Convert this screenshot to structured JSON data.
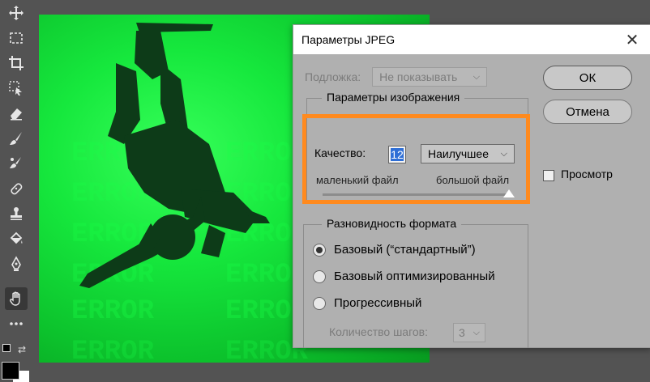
{
  "dialog": {
    "title": "Параметры JPEG",
    "matte_label": "Подложка:",
    "matte_value": "Не показывать",
    "image_options": {
      "title": "Параметры изображения",
      "quality_label": "Качество:",
      "quality_value": "12",
      "quality_preset": "Наилучшее",
      "small_file_label": "маленький файл",
      "large_file_label": "большой файл",
      "quality_slider_fraction": 1.0
    },
    "format_options": {
      "title": "Разновидность формата",
      "options": [
        {
          "label": "Базовый (“стандартный”)",
          "checked": true
        },
        {
          "label": "Базовый оптимизированный",
          "checked": false
        },
        {
          "label": "Прогрессивный",
          "checked": false
        }
      ],
      "scans_label": "Количество шагов:",
      "scans_value": "3"
    },
    "buttons": {
      "ok": "ОК",
      "cancel": "Отмена"
    },
    "preview_label": "Просмотр",
    "preview_checked": false
  },
  "colors": {
    "highlight": "#ff8a1e",
    "foreground": "#000000",
    "background": "#ffffff"
  }
}
